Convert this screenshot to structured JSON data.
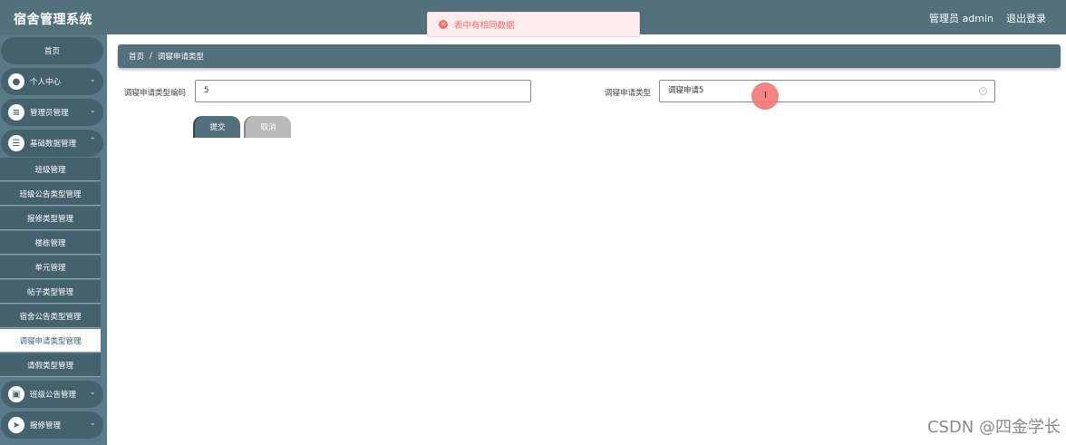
{
  "app": {
    "title": "宿舍管理系统"
  },
  "header": {
    "user_label": "管理员 admin",
    "logout": "退出登录"
  },
  "toast": {
    "message": "表中有相同数据"
  },
  "sidebar": {
    "home": "首页",
    "groups": [
      {
        "label": "个人中心",
        "icon": "user-icon"
      },
      {
        "label": "管理员管理",
        "icon": "admin-icon"
      },
      {
        "label": "基础数据管理",
        "icon": "list-icon"
      }
    ],
    "sub_items": [
      "班级管理",
      "班级公告类型管理",
      "报修类型管理",
      "楼栋管理",
      "单元管理",
      "帖子类型管理",
      "宿舍公告类型管理",
      "调寝申请类型管理",
      "请假类型管理"
    ],
    "bottom_groups": [
      {
        "label": "班级公告管理",
        "icon": "notice-icon"
      },
      {
        "label": "报修管理",
        "icon": "send-icon"
      }
    ]
  },
  "breadcrumb": {
    "home": "首页",
    "separator": "/",
    "current": "调寝申请类型"
  },
  "form": {
    "code_label": "调寝申请类型编码",
    "code_value": "5",
    "type_label": "调寝申请类型",
    "type_value": "调寝申请5"
  },
  "buttons": {
    "submit": "提交",
    "cancel": "取消"
  },
  "watermark": "CSDN @四金学长"
}
